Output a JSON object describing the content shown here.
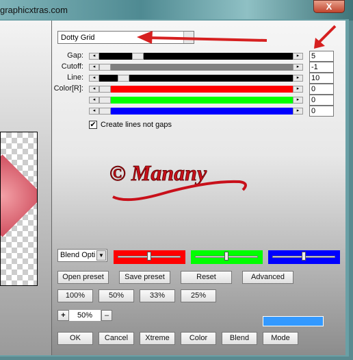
{
  "window": {
    "title": "graphicxtras.com",
    "close_label": "X"
  },
  "preset_combo": {
    "value": "Dotty Grid"
  },
  "sliders": [
    {
      "label": "Gap:",
      "value": "5",
      "color": "#000000",
      "fill": 0.18
    },
    {
      "label": "Cutoff:",
      "value": "-1",
      "color": "#808080",
      "fill": 0.0
    },
    {
      "label": "Line:",
      "value": "10",
      "color": "#000000",
      "fill": 0.1
    },
    {
      "label": "Color[R]:",
      "value": "0",
      "color": "#ff0000",
      "fill": 0.0
    },
    {
      "label": "",
      "value": "0",
      "color": "#00ff00",
      "fill": 0.0
    },
    {
      "label": "",
      "value": "0",
      "color": "#0000ff",
      "fill": 0.0
    }
  ],
  "checkbox": {
    "label": "Create lines not gaps",
    "checked": true
  },
  "watermark": {
    "text": "© Manany"
  },
  "blend": {
    "value": "Blend Opti"
  },
  "color_sliders": [
    {
      "color": "#ff0000",
      "position": 0.5
    },
    {
      "color": "#00ff00",
      "position": 0.5
    },
    {
      "color": "#0000ff",
      "position": 0.5
    }
  ],
  "buttons": {
    "open_preset": "Open preset",
    "save_preset": "Save preset",
    "reset": "Reset",
    "advanced": "Advanced"
  },
  "zoom_buttons": [
    "100%",
    "50%",
    "33%",
    "25%"
  ],
  "zoom": {
    "plus": "+",
    "value": "50%",
    "minus": "–"
  },
  "color_swatch": "#3399ff",
  "bottom_buttons": [
    "OK",
    "Cancel",
    "Xtreme",
    "Color",
    "Blend",
    "Mode"
  ]
}
